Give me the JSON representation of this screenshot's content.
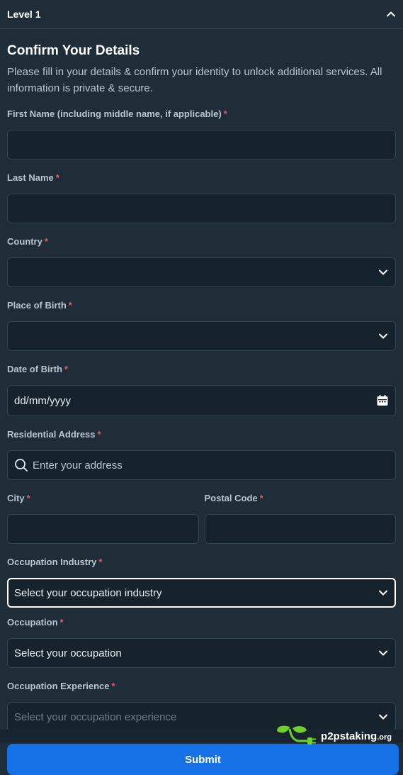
{
  "header": {
    "title": "Level 1"
  },
  "form": {
    "title": "Confirm Your Details",
    "subtitle": "Please fill in your details & confirm your identity to unlock additional services. All information is private & secure.",
    "required_mark": "*",
    "first_name": {
      "label": "First Name (including middle name, if applicable)",
      "value": ""
    },
    "last_name": {
      "label": "Last Name",
      "value": ""
    },
    "country": {
      "label": "Country",
      "value": ""
    },
    "place_of_birth": {
      "label": "Place of Birth",
      "value": ""
    },
    "date_of_birth": {
      "label": "Date of Birth",
      "placeholder": "dd/mm/yyyy"
    },
    "address": {
      "label": "Residential Address",
      "placeholder": "Enter your address"
    },
    "city": {
      "label": "City",
      "value": ""
    },
    "postal_code": {
      "label": "Postal Code",
      "value": ""
    },
    "occupation_industry": {
      "label": "Occupation Industry",
      "placeholder": "Select your occupation industry"
    },
    "occupation": {
      "label": "Occupation",
      "placeholder": "Select your occupation"
    },
    "occupation_experience": {
      "label": "Occupation Experience",
      "placeholder": "Select your occupation experience"
    },
    "submit_label": "Submit"
  },
  "watermark": {
    "name": "p2pstaking",
    "tld": ".org"
  },
  "colors": {
    "accent": "#1771e6",
    "background": "#1e2d38",
    "field": "#17232c",
    "required": "#e55a6a"
  }
}
